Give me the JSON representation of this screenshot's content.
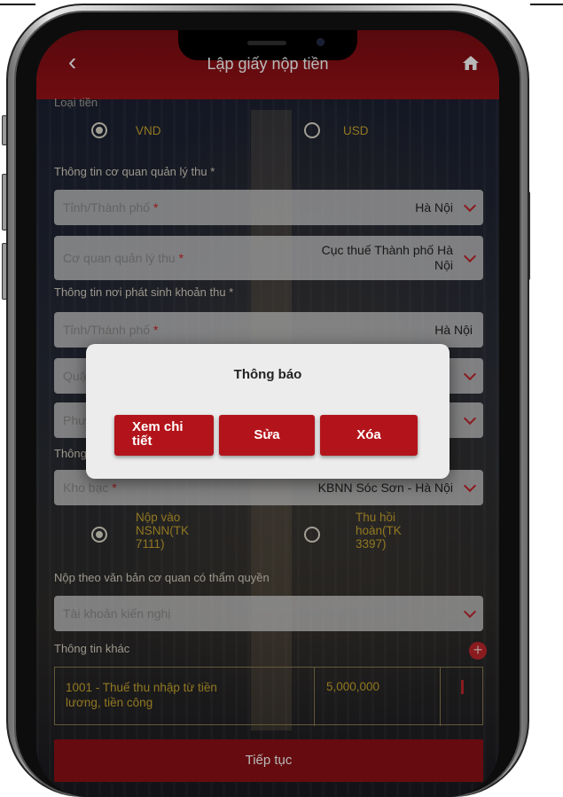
{
  "header": {
    "title": "Lập giấy nộp tiền"
  },
  "currency": {
    "section_label": "Loại tiền",
    "options": [
      {
        "label": "VND",
        "selected": true
      },
      {
        "label": "USD",
        "selected": false
      }
    ]
  },
  "agency_info": {
    "section_label": "Thông tin cơ quan quản lý thu *",
    "province": {
      "label": "Tỉnh/Thành phố",
      "required_mark": "*",
      "value": "Hà Nội"
    },
    "agency": {
      "label": "Cơ quan quản lý thu",
      "required_mark": "*",
      "value_line1": "Cục thuế Thành phố Hà",
      "value_line2": "Nội"
    }
  },
  "origin_info": {
    "section_label": "Thông tin nơi phát sinh khoản thu *",
    "province": {
      "label": "Tỉnh/Thành phố",
      "required_mark": "*",
      "value": "Hà Nội"
    },
    "district": {
      "label": "Quận/Huyện",
      "required_mark": "*"
    },
    "ward": {
      "label": "Phường"
    }
  },
  "treasury_section_label": "Thông",
  "treasury": {
    "label": "Kho bạc",
    "required_mark": "*",
    "value": "KBNN Sóc Sơn - Hà Nội"
  },
  "account_options": [
    {
      "lines": [
        "Nộp vào",
        "NSNN(TK",
        "7111)"
      ],
      "selected": true
    },
    {
      "lines": [
        "Thu hồi",
        "hoàn(TK",
        "3397)"
      ],
      "selected": false
    }
  ],
  "authority_doc": {
    "section_label": "Nộp theo văn bản cơ quan có thẩm quyền",
    "placeholder": "Tài khoản kiến nghị"
  },
  "other_info": {
    "section_label": "Thông tin khác",
    "items": [
      {
        "description_line1": "1001 - Thuế thu nhập từ tiền",
        "description_line2": "lương, tiền công",
        "amount": "5,000,000"
      }
    ]
  },
  "continue_label": "Tiếp tục",
  "dialog": {
    "title": "Thông báo",
    "buttons": {
      "detail_line1": "Xem chi",
      "detail_line2": "tiết",
      "edit": "Sửa",
      "delete": "Xóa"
    }
  },
  "colors": {
    "header": "#9b1218",
    "accent": "#c0262b",
    "gold_text": "#c9a62e",
    "dialog_bg": "#ececec",
    "button": "#b3141b"
  }
}
